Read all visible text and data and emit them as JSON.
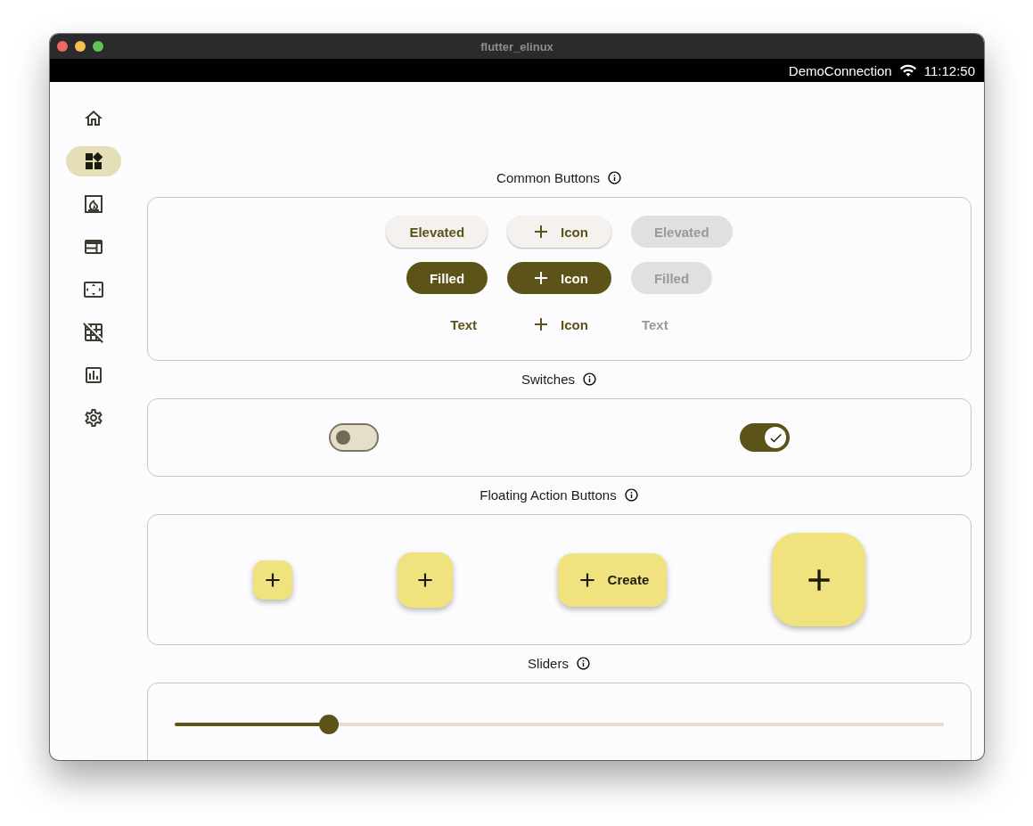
{
  "window": {
    "title": "flutter_elinux"
  },
  "status_bar": {
    "network": "DemoConnection",
    "time": "11:12:50"
  },
  "nav": [
    {
      "kind": "home",
      "selected": false
    },
    {
      "kind": "widgets",
      "selected": true
    },
    {
      "kind": "fireplace",
      "selected": false
    },
    {
      "kind": "layout",
      "selected": false
    },
    {
      "kind": "spacing",
      "selected": false
    },
    {
      "kind": "grid-off",
      "selected": false
    },
    {
      "kind": "chart",
      "selected": false
    },
    {
      "kind": "settings",
      "selected": false
    }
  ],
  "sections": [
    {
      "kind": "buttons",
      "title": "Common Buttons",
      "buttons": [
        {
          "kind": "elevated",
          "label": "Elevated",
          "icon": false,
          "disabled": false
        },
        {
          "kind": "elevated",
          "label": "Icon",
          "icon": true,
          "disabled": false
        },
        {
          "kind": "elevated",
          "label": "Elevated",
          "icon": false,
          "disabled": true
        },
        {
          "kind": "filled",
          "label": "Filled",
          "icon": false,
          "disabled": false
        },
        {
          "kind": "filled",
          "label": "Icon",
          "icon": true,
          "disabled": false
        },
        {
          "kind": "filled",
          "label": "Filled",
          "icon": false,
          "disabled": true
        },
        {
          "kind": "text",
          "label": "Text",
          "icon": false,
          "disabled": false
        },
        {
          "kind": "text",
          "label": "Icon",
          "icon": true,
          "disabled": false
        },
        {
          "kind": "text",
          "label": "Text",
          "icon": false,
          "disabled": true
        }
      ]
    },
    {
      "kind": "switches",
      "title": "Switches",
      "switches": [
        {
          "on": false
        },
        {
          "on": true
        }
      ]
    },
    {
      "kind": "fabs",
      "title": "Floating Action Buttons",
      "fabs": [
        {
          "kind": "small"
        },
        {
          "kind": "regular"
        },
        {
          "kind": "extended",
          "label": "Create"
        },
        {
          "kind": "large"
        }
      ]
    },
    {
      "kind": "sliders",
      "title": "Sliders",
      "sliders": [
        {
          "level": 0.2
        }
      ]
    }
  ]
}
